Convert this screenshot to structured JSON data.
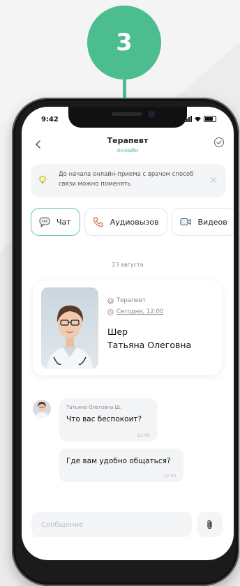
{
  "step": "3",
  "status": {
    "time": "9:42"
  },
  "header": {
    "title": "Терапевт",
    "subtitle": "онлайн"
  },
  "banner": {
    "text": "До начала онлайн-приема с врачом способ связи можно поменять"
  },
  "tabs": [
    {
      "label": "Чат",
      "icon": "chat-icon",
      "active": true
    },
    {
      "label": "Аудиовызов",
      "icon": "phone-icon",
      "active": false
    },
    {
      "label": "Видеов",
      "icon": "video-icon",
      "active": false
    }
  ],
  "date_separator": "23 августа",
  "doctor": {
    "role": "Терапевт",
    "time": "Сегодня, 12:00",
    "last_name": "Шер",
    "first_name": "Татьяна Олеговна"
  },
  "messages": [
    {
      "author": "Татьяна Олеговна Ш.",
      "text": "Что вас беспокоит?",
      "time": "12:00"
    },
    {
      "author": "",
      "text": "Где вам удобно общаться?",
      "time": "12:01"
    }
  ],
  "composer": {
    "placeholder": "Сообщение"
  },
  "colors": {
    "accent": "#4bbd8f",
    "bubble": "#f3f4f6",
    "banner": "#f4f5f7"
  }
}
